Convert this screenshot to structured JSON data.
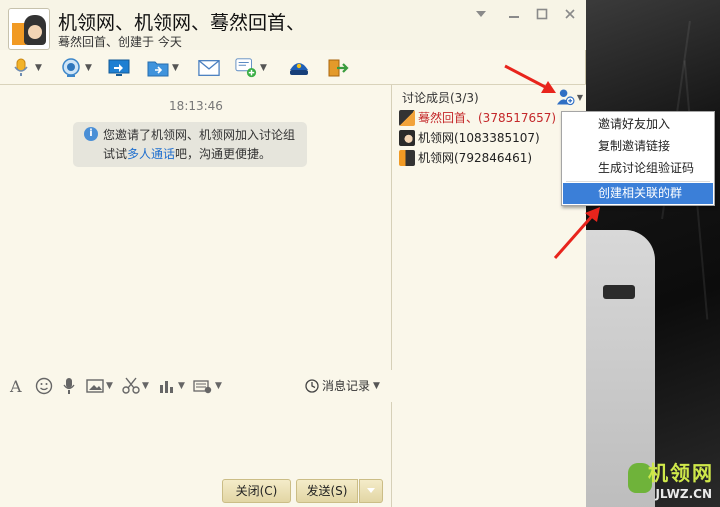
{
  "window": {
    "title": "机领网、机领网、蓦然回首、",
    "subtitle": "蓦然回首、创建于 今天",
    "minimize_icon": "chevron-down-icon",
    "colors": {
      "bg": "#faf7ea",
      "accent": "#3b7fd8",
      "owner": "#c4282a",
      "link": "#1f6fcf"
    }
  },
  "chat": {
    "time": "18:13:46",
    "notice_pre": "您邀请了机领网、机领网加入讨论组试试",
    "notice_link": "多人通话",
    "notice_post": "吧，沟通更便捷。"
  },
  "input_toolbar": {
    "history_label": "消息记录"
  },
  "buttons": {
    "close": "关闭(C)",
    "send": "发送(S)"
  },
  "members": {
    "title": "讨论成员(3/3)",
    "list": [
      {
        "name": "蓦然回首、(378517657)",
        "role": "owner"
      },
      {
        "name": "机领网(1083385107)",
        "role": "member"
      },
      {
        "name": "机领网(792846461)",
        "role": "member"
      }
    ]
  },
  "menu": {
    "items": [
      {
        "label": "邀请好友加入"
      },
      {
        "label": "复制邀请链接"
      },
      {
        "label": "生成讨论组验证码"
      },
      {
        "label": "创建相关联的群"
      }
    ],
    "active_index": 3
  },
  "watermark": {
    "text_top": "机领网",
    "text_bottom": "JLWZ.CN"
  }
}
